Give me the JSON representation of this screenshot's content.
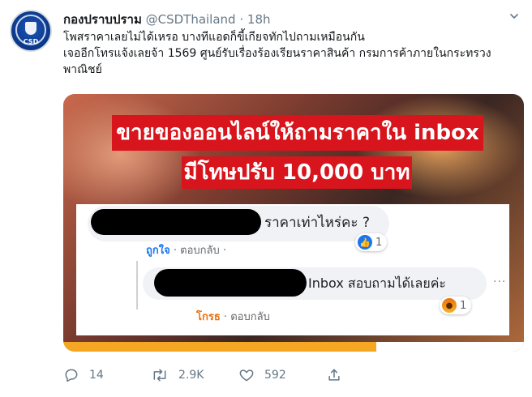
{
  "tweet": {
    "display_name": "กองปราบปราม",
    "handle": "@CSDThailand",
    "separator": "·",
    "time": "18h",
    "avatar_text": "CSD",
    "text_lines": [
      "โพสราคาเลยไม่ได้เหรอ บางทีแอดก็ขี้เกียจทักไปถามเหมือนกัน",
      "เจออีกโทรแจ้งเลยจ้า 1569 ศูนย์รับเรื่องร้องเรียนราคาสินค้า กรมการค้าภายในกระทรวง",
      "พาณิชย์"
    ]
  },
  "media": {
    "banner_line1": "ขายของออนไลน์ให้ถามราคาใน inbox",
    "banner_line2": "มีโทษปรับ 10,000 บาท",
    "comment1": {
      "text": "ราคาเท่าไหร่คะ ?",
      "reaction_count": "1",
      "like_action": "ถูกใจ",
      "separator": "·",
      "reply_action": "ตอบกลับ",
      "separator2": "·"
    },
    "comment2": {
      "text": "Inbox สอบถามได้เลยค่ะ",
      "reaction_count": "1",
      "angry_action": "โกรธ",
      "separator": "·",
      "reply_action": "ตอบกลับ",
      "more": "···"
    }
  },
  "actions": {
    "reply_count": "14",
    "retweet_count": "2.9K",
    "like_count": "592"
  },
  "colors": {
    "banner_red": "#d8141c",
    "fb_blue": "#1877f2",
    "angry_orange": "#e9710f",
    "muted_gray": "#657786"
  }
}
